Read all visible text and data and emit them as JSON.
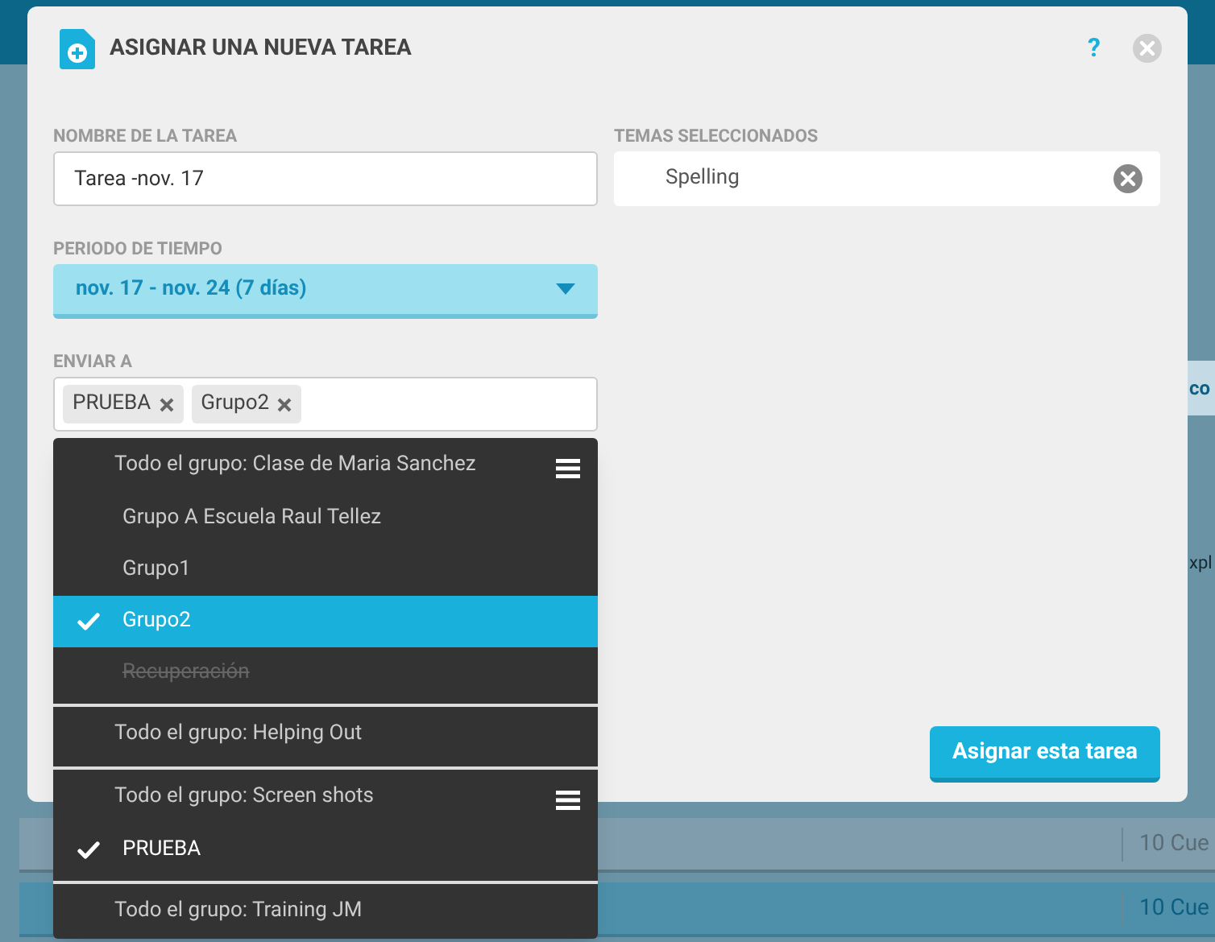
{
  "background": {
    "side_texts": [
      "co",
      "xpl"
    ],
    "rows": [
      {
        "count": "10 Cue",
        "selected": false
      },
      {
        "count": "10 Cue",
        "selected": true
      }
    ]
  },
  "dialog": {
    "title": "ASIGNAR UNA NUEVA TAREA",
    "help": "?",
    "task_name": {
      "label": "NOMBRE DE LA TAREA",
      "value": "Tarea -nov. 17"
    },
    "topics": {
      "label": "TEMAS SELECCIONADOS",
      "items": [
        "Spelling"
      ]
    },
    "period": {
      "label": "PERIODO DE TIEMPO",
      "value": "nov. 17 - nov. 24 (7 días)"
    },
    "send_to": {
      "label": "ENVIAR A",
      "tags": [
        "PRUEBA",
        "Grupo2"
      ]
    },
    "groups": [
      {
        "header": "Todo el grupo: Clase de Maria Sanchez",
        "menu": true,
        "items": [
          {
            "label": "Grupo A Escuela Raul Tellez",
            "selected": false,
            "disabled": false
          },
          {
            "label": "Grupo1",
            "selected": false,
            "disabled": false
          },
          {
            "label": "Grupo2",
            "selected": true,
            "disabled": false
          },
          {
            "label": "Recuperación",
            "selected": false,
            "disabled": true
          }
        ]
      },
      {
        "header": "Todo el grupo: Helping Out",
        "menu": false
      },
      {
        "header": "Todo el grupo: Screen shots",
        "menu": true,
        "items": [
          {
            "label": "PRUEBA",
            "selected": true,
            "disabled": false
          }
        ]
      },
      {
        "header": "Todo el grupo: Training JM",
        "menu": false
      }
    ],
    "submit": "Asignar esta tarea"
  }
}
